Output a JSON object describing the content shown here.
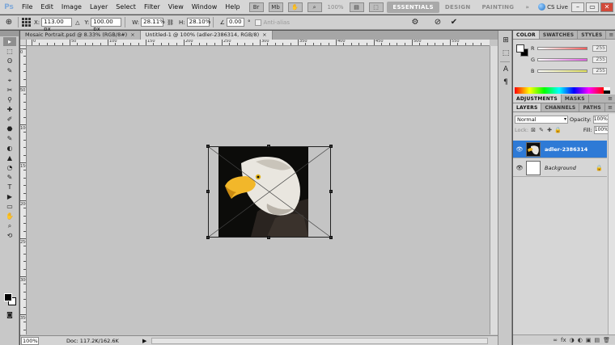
{
  "app": {
    "logo": "Ps",
    "menus": [
      "File",
      "Edit",
      "Image",
      "Layer",
      "Select",
      "Filter",
      "View",
      "Window",
      "Help"
    ],
    "zoom_readout": "100%",
    "workspaces": [
      {
        "label": "ESSENTIALS",
        "active": true
      },
      {
        "label": "DESIGN",
        "active": false
      },
      {
        "label": "PAINTING",
        "active": false
      }
    ],
    "more_workspaces": "»",
    "cs_live": "CS Live",
    "window_controls": {
      "minimize": "–",
      "restore": "▭",
      "close": "✕"
    }
  },
  "options_bar": {
    "x_label": "X:",
    "x_value": "113.00 px",
    "y_label": "Y:",
    "y_value": "100.00 px",
    "w_label": "W:",
    "w_value": "28.11%",
    "h_label": "H:",
    "h_value": "28.10%",
    "angle_value": "0.00",
    "angle_unit": "°",
    "antialias_label": "Anti-alias"
  },
  "documents": {
    "tabs": [
      {
        "label": "Mosaic Portrait.psd @ 8.33% (RGB/8#)",
        "active": false
      },
      {
        "label": "Untitled-1 @ 100% (adler-2386314, RGB/8)",
        "active": true
      }
    ],
    "close_glyph": "×"
  },
  "rulers": {
    "h_labels": [
      "0",
      "50",
      "100",
      "150",
      "200",
      "250",
      "300",
      "350",
      "400",
      "450",
      "500",
      "550"
    ],
    "v_labels": [
      "0",
      "50",
      "100",
      "150",
      "200",
      "250",
      "300",
      "350"
    ]
  },
  "status": {
    "zoom": "100%",
    "doc_info": "Doc: 117.2K/162.6K",
    "arrow": "▶"
  },
  "tools": [
    "▸",
    "⬚",
    "ʘ",
    "✎",
    "⌖",
    "✂",
    "⚲",
    "✚",
    "✐",
    "⬣",
    "✎",
    "◐",
    "▲",
    "◔",
    "✎",
    "T",
    "▶",
    "▭",
    "✋",
    "⌕",
    "⟲"
  ],
  "panels": {
    "color_tabs": [
      {
        "label": "COLOR",
        "active": true
      },
      {
        "label": "SWATCHES",
        "active": false
      },
      {
        "label": "STYLES",
        "active": false
      }
    ],
    "color_sliders": [
      {
        "label": "R",
        "value": "255",
        "gradient": "#ff5a5a"
      },
      {
        "label": "G",
        "value": "255",
        "gradient": "#5aff5a"
      },
      {
        "label": "B",
        "value": "255",
        "gradient": "#5a5aff"
      }
    ],
    "adjust_tabs": [
      {
        "label": "ADJUSTMENTS",
        "active": true
      },
      {
        "label": "MASKS",
        "active": false
      }
    ],
    "layers_tabs": [
      {
        "label": "LAYERS",
        "active": true
      },
      {
        "label": "CHANNELS",
        "active": false
      },
      {
        "label": "PATHS",
        "active": false
      }
    ],
    "panel_menu": "≡",
    "blend_mode": "Normal",
    "opacity_label": "Opacity:",
    "opacity_value": "100%",
    "lock_label": "Lock:",
    "lock_icons": [
      "⊠",
      "✎",
      "✚",
      "🔒"
    ],
    "fill_label": "Fill:",
    "fill_value": "100%",
    "layers": [
      {
        "name": "adler-2386314",
        "selected": true,
        "eye": "👁",
        "lock": ""
      },
      {
        "name": "Background",
        "selected": false,
        "eye": "👁",
        "lock": "🔒"
      }
    ],
    "bottom_icons": [
      "∞",
      "fx",
      "◑",
      "◐",
      "▣",
      "▤",
      "🗑"
    ]
  },
  "dock_icons": [
    "⊞",
    "⬚",
    "A",
    "¶"
  ]
}
